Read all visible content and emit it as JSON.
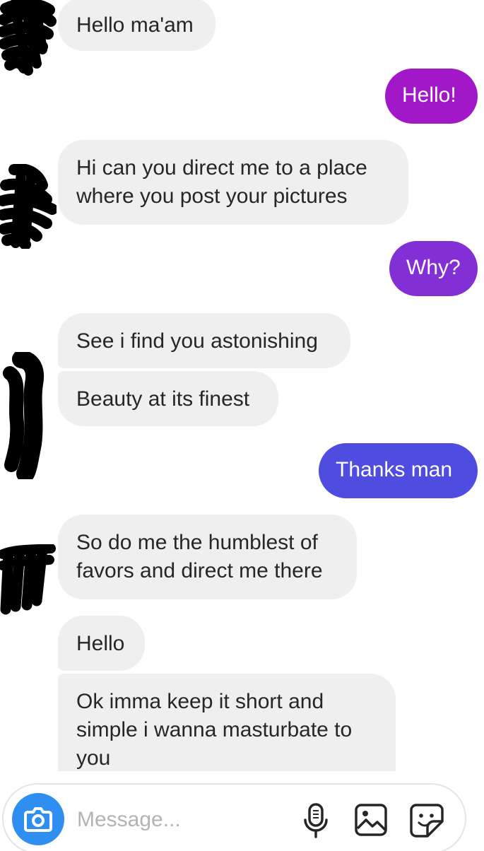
{
  "conversation": {
    "messages": [
      {
        "sender": "them",
        "text": "Hello ma'am"
      },
      {
        "sender": "me",
        "text": "Hello!",
        "color": "#a218c9"
      },
      {
        "sender": "them",
        "text": "Hi can you direct me to a place\nwhere you post your pictures"
      },
      {
        "sender": "me",
        "text": "Why?",
        "color": "#8230d6"
      },
      {
        "sender": "them",
        "text": "See i find you astonishing"
      },
      {
        "sender": "them",
        "text": "Beauty at its finest"
      },
      {
        "sender": "me",
        "text": "Thanks man",
        "color": "#4f4ce0"
      },
      {
        "sender": "them",
        "text": "So do me the humblest of\nfavors and direct me there"
      },
      {
        "sender": "them",
        "text": "Hello"
      },
      {
        "sender": "them",
        "text": "Ok imma keep it short and\nsimple i wanna masturbate to\nyou"
      }
    ]
  },
  "composer": {
    "placeholder": "Message...",
    "camera_icon": "camera-icon",
    "mic_icon": "microphone-icon",
    "gallery_icon": "image-icon",
    "sticker_icon": "sticker-icon",
    "camera_color": "#2f8ff0"
  }
}
